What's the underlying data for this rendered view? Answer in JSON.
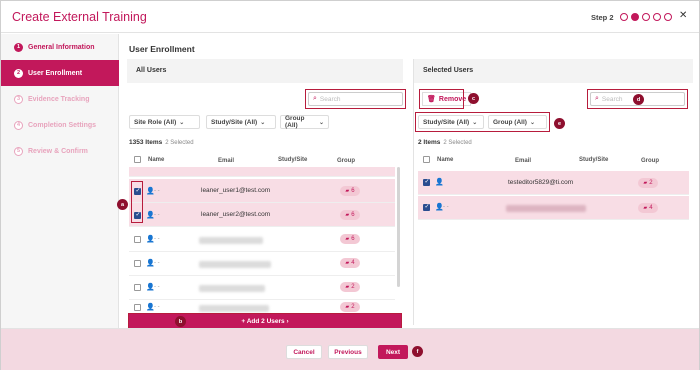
{
  "header": {
    "title": "Create External Training",
    "step_label": "Step 2",
    "close_glyph": "✕",
    "total_steps": 5,
    "current_step": 2
  },
  "sidebar": {
    "items": [
      {
        "num": "1",
        "label": "General Information",
        "state": "done"
      },
      {
        "num": "2",
        "label": "User Enrollment",
        "state": "active"
      },
      {
        "num": "3",
        "label": "Evidence Tracking",
        "state": "todo"
      },
      {
        "num": "4",
        "label": "Completion Settings",
        "state": "todo"
      },
      {
        "num": "5",
        "label": "Review & Confirm",
        "state": "todo"
      }
    ]
  },
  "main": {
    "title": "User Enrollment"
  },
  "left_panel": {
    "title": "All Users",
    "search_placeholder": "Search",
    "filters": [
      "Site Role (All)",
      "Study/Site (All)",
      "Group (All)"
    ],
    "count_label": "1353 Items",
    "selected_label": "2 Selected",
    "columns": [
      "Name",
      "Email",
      "Study/Site",
      "Group"
    ],
    "rows": [
      {
        "checked": true,
        "email": "leaner_user1@test.com",
        "group": "6"
      },
      {
        "checked": true,
        "email": "leaner_user2@test.com",
        "group": "6"
      },
      {
        "checked": false,
        "email": "",
        "group": "6"
      },
      {
        "checked": false,
        "email": "",
        "group": "4"
      },
      {
        "checked": false,
        "email": "",
        "group": "2"
      },
      {
        "checked": false,
        "email": "",
        "group": "2"
      }
    ],
    "add_button": "+ Add 2 Users ›"
  },
  "right_panel": {
    "title": "Selected Users",
    "remove_label": "Remove",
    "search_placeholder": "Search",
    "filters": [
      "Study/Site (All)",
      "Group (All)"
    ],
    "count_label": "2 Items",
    "selected_label": "2 Selected",
    "columns": [
      "Name",
      "Email",
      "Study/Site",
      "Group"
    ],
    "rows": [
      {
        "checked": true,
        "email": "testeditor5829@ti.com",
        "group": "2"
      },
      {
        "checked": true,
        "email": "",
        "group": "4"
      }
    ]
  },
  "callouts": {
    "a": "a",
    "b": "b",
    "c": "c",
    "d": "d",
    "e": "e",
    "f": "f"
  },
  "footer": {
    "cancel": "Cancel",
    "previous": "Previous",
    "next": "Next"
  },
  "colors": {
    "accent": "#c2185b",
    "selected_row": "#f8dde5",
    "callout": "#8e0f2e"
  }
}
